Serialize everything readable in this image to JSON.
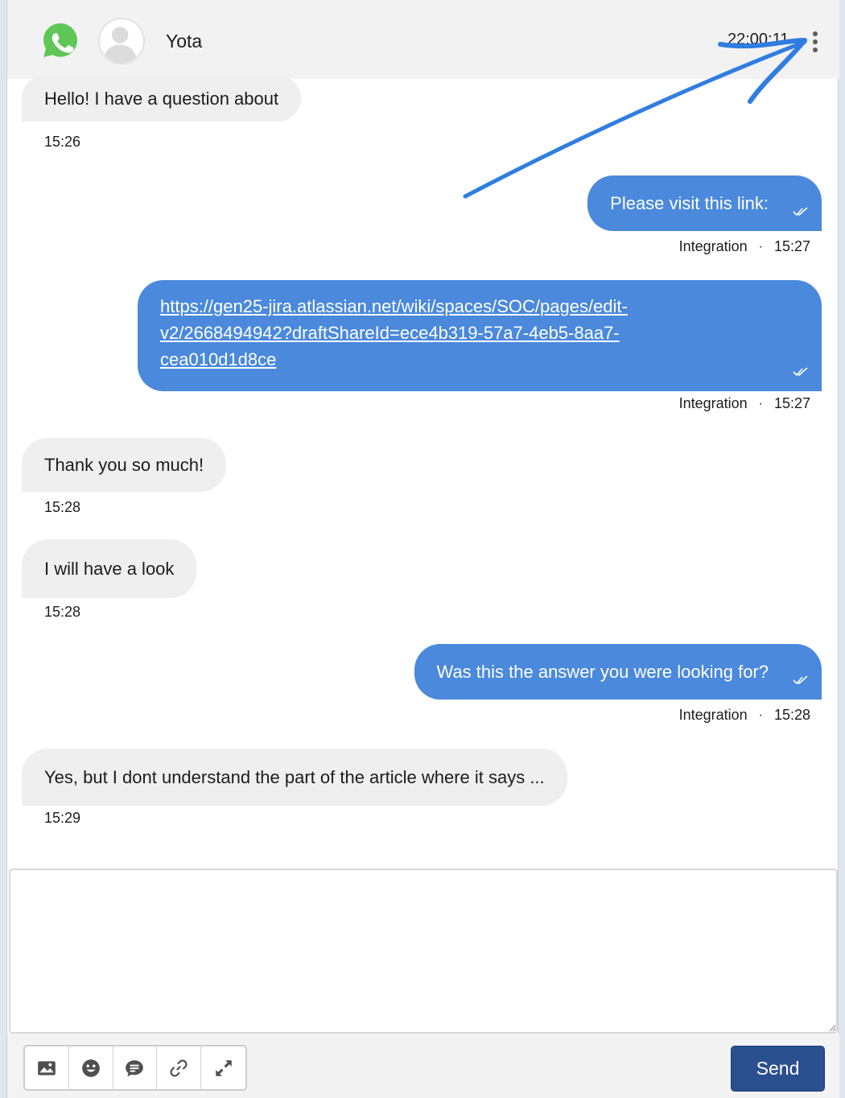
{
  "header": {
    "contact_name": "Yota",
    "time": "22:00:11",
    "app_icon": "whatsapp-icon",
    "menu_icon": "more-vertical-icon"
  },
  "messages": [
    {
      "direction": "inbound",
      "text": "Hello! I have a question about",
      "time": "15:26"
    },
    {
      "direction": "outbound",
      "text": "Please visit this link:",
      "sender": "Integration",
      "time": "15:27"
    },
    {
      "direction": "outbound",
      "type": "link",
      "lines": [
        "https://gen25-jira.atlassian.net/wiki/spaces/SOC/pages/edit-",
        "v2/2668494942?draftShareId=ece4b319-57a7-4eb5-8aa7-",
        "cea010d1d8ce"
      ],
      "sender": "Integration",
      "time": "15:27"
    },
    {
      "direction": "inbound",
      "text": "Thank you so much!",
      "time": "15:28"
    },
    {
      "direction": "inbound",
      "text": "I will have a look",
      "time": "15:28"
    },
    {
      "direction": "outbound",
      "text": "Was this the answer you were looking for?",
      "sender": "Integration",
      "time": "15:28"
    },
    {
      "direction": "inbound",
      "text": "Yes, but I dont understand the part of the article where it says ...",
      "time": "15:29"
    }
  ],
  "meta_separator": "·",
  "composer": {
    "placeholder": ""
  },
  "toolbar": {
    "icons": [
      "image-icon",
      "emoji-icon",
      "quick-reply-icon",
      "link-icon",
      "expand-icon"
    ],
    "send_label": "Send"
  },
  "colors": {
    "outbound_bubble": "#4a89dc",
    "inbound_bubble": "#efefef",
    "send_button": "#2a4f8f",
    "annotation_arrow": "#2f7de1"
  }
}
